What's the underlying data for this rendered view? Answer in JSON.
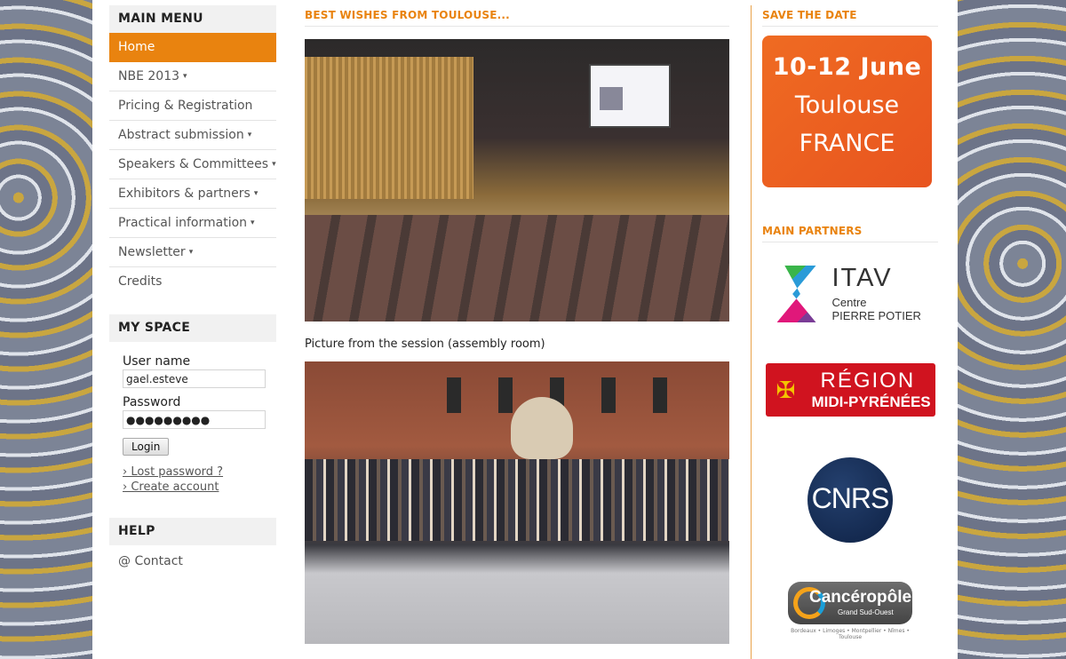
{
  "main_menu": {
    "title": "MAIN MENU",
    "items": [
      {
        "label": "Home",
        "arrow": ""
      },
      {
        "label": "NBE 2013",
        "arrow": "▾"
      },
      {
        "label": "Pricing & Registration",
        "arrow": ""
      },
      {
        "label": "Abstract submission",
        "arrow": "▾"
      },
      {
        "label": "Speakers & Committees",
        "arrow": "▾"
      },
      {
        "label": "Exhibitors & partners",
        "arrow": "▾"
      },
      {
        "label": "Practical information",
        "arrow": "▾"
      },
      {
        "label": "Newsletter",
        "arrow": "▾"
      },
      {
        "label": "Credits",
        "arrow": ""
      }
    ]
  },
  "my_space": {
    "title": "MY SPACE",
    "username_label": "User name",
    "username_value": "gael.esteve",
    "password_label": "Password",
    "password_value": "●●●●●●●●●",
    "login_label": "Login",
    "lost_password": "› Lost password ?",
    "create_account": "› Create account"
  },
  "help": {
    "title": "HELP",
    "contact": "@ Contact"
  },
  "center": {
    "title": "BEST WISHES FROM TOULOUSE...",
    "caption": "Picture from the session (assembly room)"
  },
  "right": {
    "save_title": "SAVE THE DATE",
    "date_line1": "10-12 June",
    "date_line2": "Toulouse",
    "date_line3": "FRANCE",
    "partners_title": "MAIN PARTNERS",
    "itav_name": "ITAV",
    "itav_sub1": "Centre",
    "itav_sub2": "PIERRE POTIER",
    "region_line1": "RÉGION",
    "region_line2": "MIDI-PYRÉNÉES",
    "cnrs_name": "CNRS",
    "canc_name": "Cancéropôle",
    "canc_sub": "Grand Sud-Ouest",
    "canc_cities": "Bordeaux • Limoges • Montpellier • Nîmes • Toulouse"
  },
  "colors": {
    "accent": "#e9830f",
    "date_banner": "#e8541f",
    "region_red": "#d0131f",
    "cnrs_blue": "#0e2144"
  }
}
